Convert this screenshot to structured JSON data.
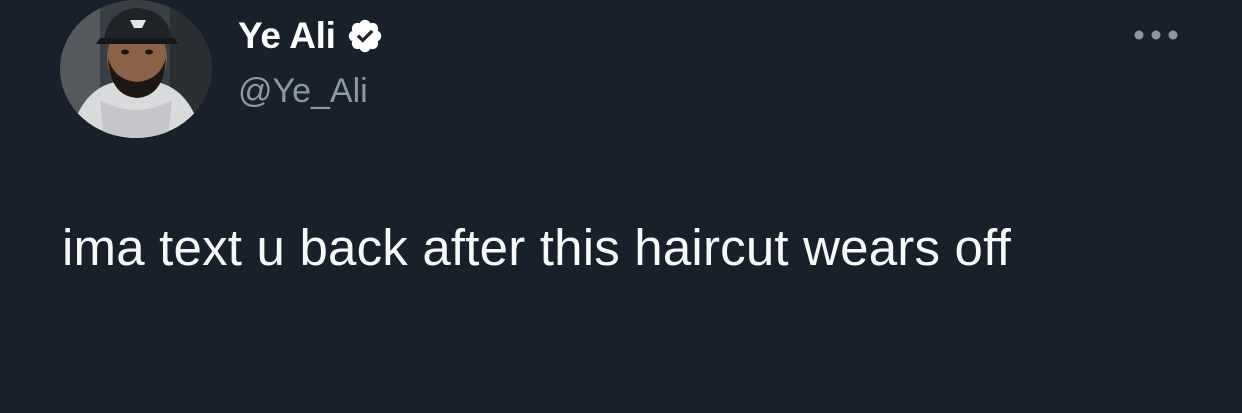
{
  "tweet": {
    "author": {
      "display_name": "Ye Ali",
      "handle": "@Ye_Ali",
      "verified": true
    },
    "text": "ima text u back after this haircut wears off"
  },
  "icons": {
    "verified": "verified-badge-icon",
    "more": "more-options-icon"
  },
  "colors": {
    "background": "#18202b",
    "text_primary": "#ffffff",
    "text_secondary": "#8b98a5"
  }
}
